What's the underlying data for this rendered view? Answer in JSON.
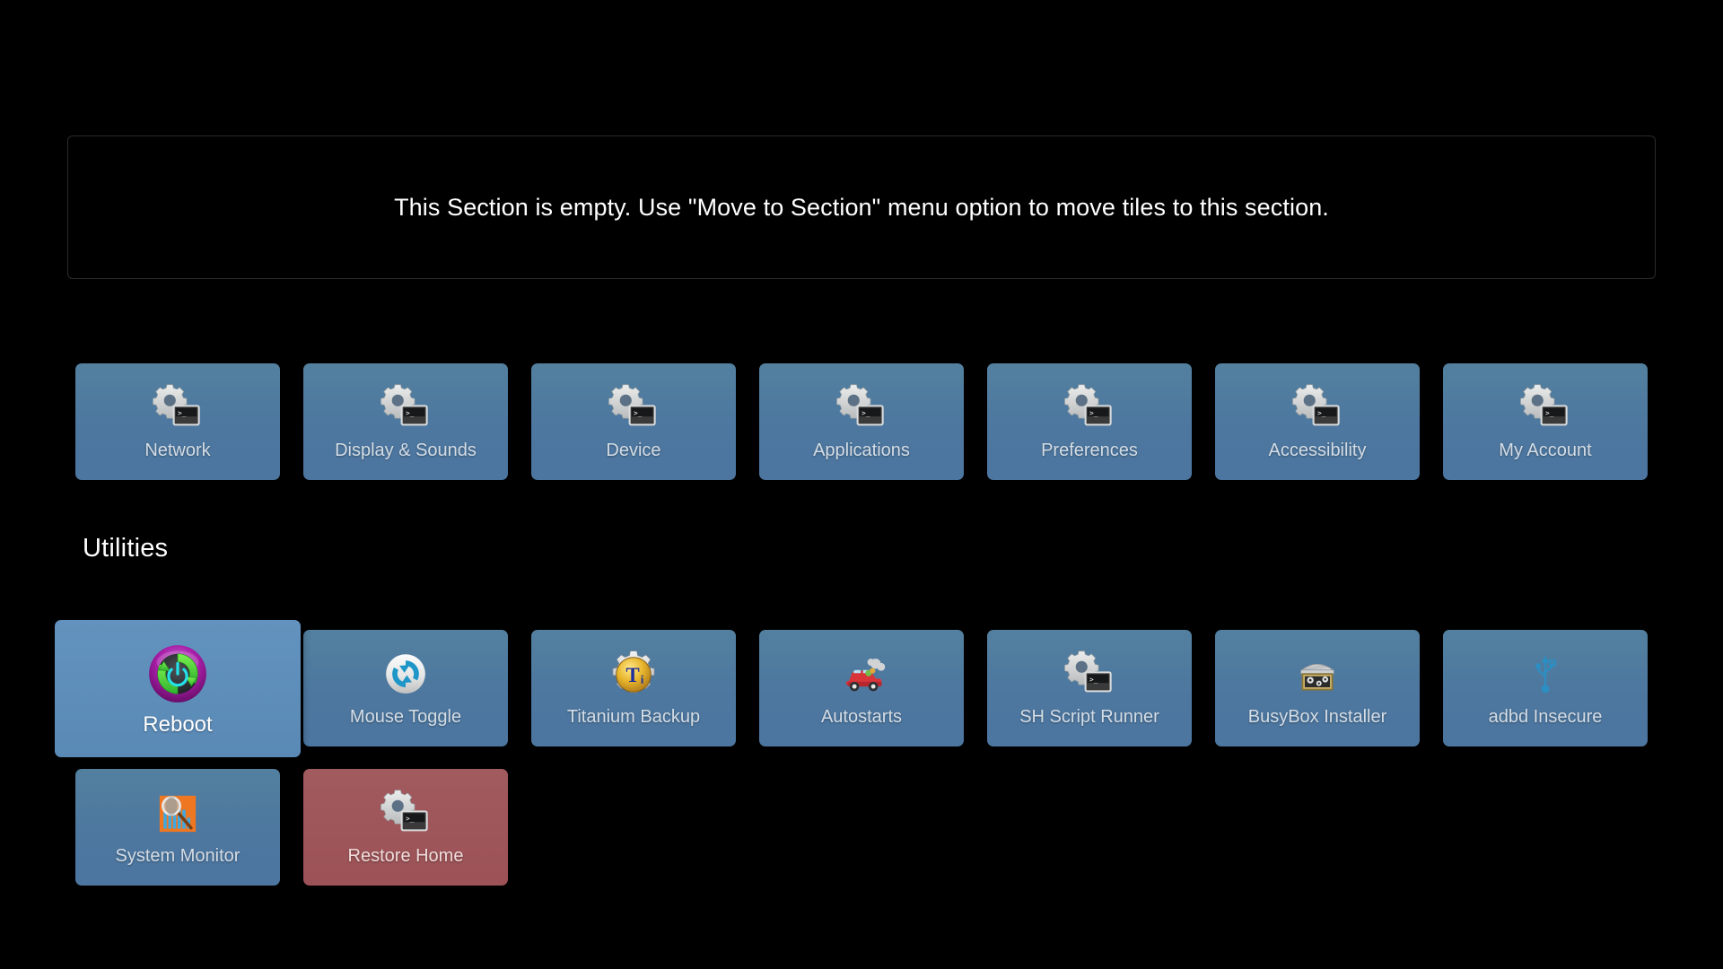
{
  "screen": {
    "background": "#000000",
    "tile_color": "#4f7ba3",
    "tile_color_focused": "#5e8ebb",
    "tile_color_danger": "#9e5459",
    "label_color": "#d4dde6"
  },
  "empty_section": {
    "message": "This Section is empty. Use \"Move to Section\" menu option to move tiles to this section."
  },
  "settings_row": {
    "tiles": [
      {
        "label": "Network",
        "icon": "gear-terminal-icon",
        "focused": false,
        "danger": false
      },
      {
        "label": "Display & Sounds",
        "icon": "gear-terminal-icon",
        "focused": false,
        "danger": false
      },
      {
        "label": "Device",
        "icon": "gear-terminal-icon",
        "focused": false,
        "danger": false
      },
      {
        "label": "Applications",
        "icon": "gear-terminal-icon",
        "focused": false,
        "danger": false
      },
      {
        "label": "Preferences",
        "icon": "gear-terminal-icon",
        "focused": false,
        "danger": false
      },
      {
        "label": "Accessibility",
        "icon": "gear-terminal-icon",
        "focused": false,
        "danger": false
      },
      {
        "label": "My Account",
        "icon": "gear-terminal-icon",
        "focused": false,
        "danger": false
      }
    ]
  },
  "utilities_section": {
    "title": "Utilities",
    "row1": [
      {
        "label": "Reboot",
        "icon": "reboot-icon",
        "focused": true,
        "danger": false
      },
      {
        "label": "Mouse Toggle",
        "icon": "mouse-toggle-icon",
        "focused": false,
        "danger": false
      },
      {
        "label": "Titanium Backup",
        "icon": "titanium-backup-icon",
        "focused": false,
        "danger": false
      },
      {
        "label": "Autostarts",
        "icon": "autostarts-car-icon",
        "focused": false,
        "danger": false
      },
      {
        "label": "SH Script Runner",
        "icon": "gear-terminal-icon",
        "focused": false,
        "danger": false
      },
      {
        "label": "BusyBox Installer",
        "icon": "busybox-toolbox-icon",
        "focused": false,
        "danger": false
      },
      {
        "label": "adbd Insecure",
        "icon": "usb-icon",
        "focused": false,
        "danger": false
      }
    ],
    "row2": [
      {
        "label": "System Monitor",
        "icon": "system-monitor-icon",
        "focused": false,
        "danger": false
      },
      {
        "label": "Restore Home",
        "icon": "gear-terminal-icon",
        "focused": false,
        "danger": true
      }
    ]
  }
}
